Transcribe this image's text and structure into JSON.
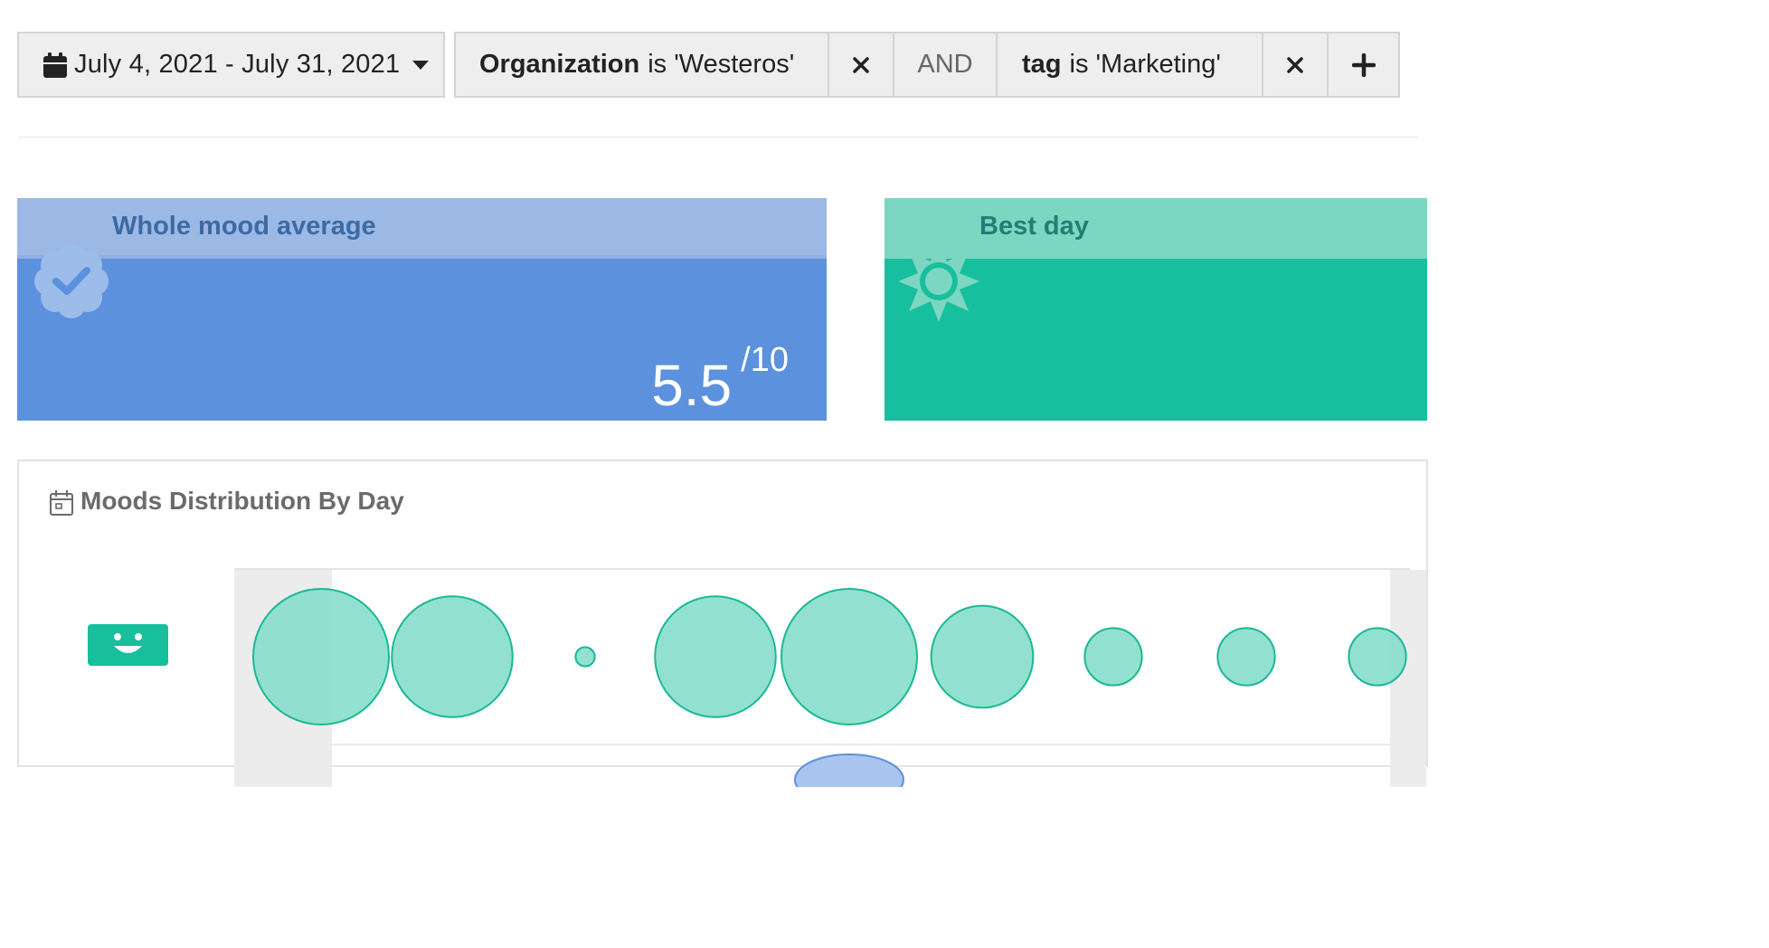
{
  "filters": {
    "date_range": "July 4, 2021 - July 31, 2021",
    "conditions": [
      {
        "field": "Organization",
        "op_value": "is 'Westeros'"
      },
      {
        "field": "tag",
        "op_value": "is 'Marketing'"
      }
    ],
    "joiner": "AND",
    "remove_glyph": "✕",
    "add_glyph": "+"
  },
  "kpis": {
    "mood_average": {
      "title": "Whole mood average",
      "value": "5.5",
      "suffix": "/10"
    },
    "best_day": {
      "title": "Best day"
    }
  },
  "distribution": {
    "title": "Moods Distribution By Day",
    "rows": [
      {
        "mood": "happy",
        "icon": "smiley-face-icon",
        "bubble_sizes": [
          5,
          4,
          0.1,
          4,
          5,
          3,
          1.5,
          1.5,
          1.5
        ]
      }
    ]
  },
  "colors": {
    "mood_card": "#5c91de",
    "best_card": "#16bf9d",
    "bubble_fill": "#8cdfcd",
    "bubble_stroke": "#1ab896"
  }
}
